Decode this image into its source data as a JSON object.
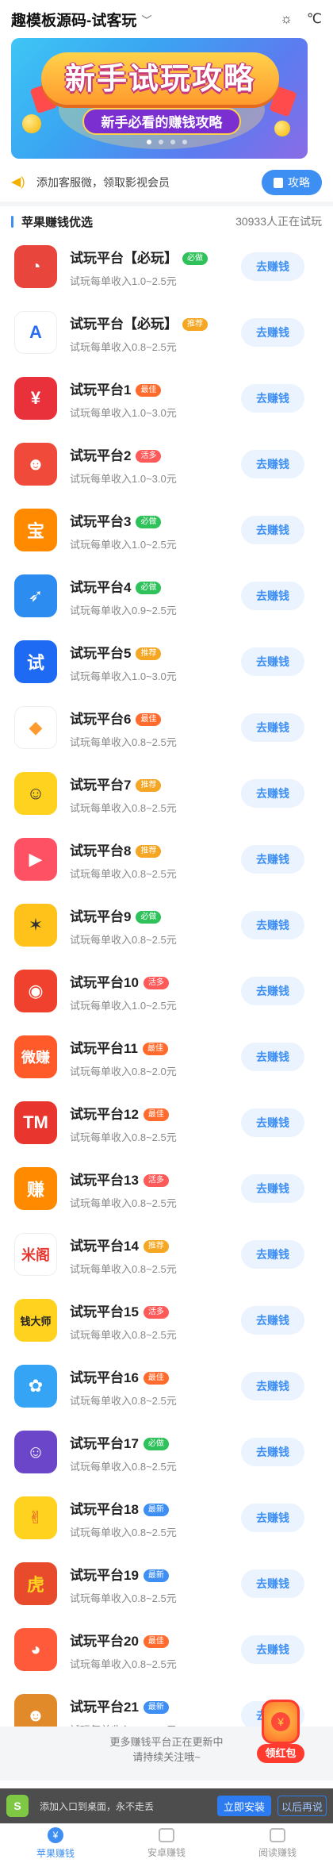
{
  "header": {
    "title": "趣模板源码-试客玩",
    "weather_sun": "☼",
    "weather_unit": "℃"
  },
  "banner": {
    "headline": "新手试玩攻略",
    "subline": "新手必看的赚钱攻略"
  },
  "notice": {
    "text": "添加客服微，领取影视会员",
    "button_label": "攻略"
  },
  "section": {
    "title": "苹果赚钱优选",
    "counter": "30933人正在试玩"
  },
  "go_label": "去赚钱",
  "tag_colors": {
    "必做": "#2fc25b",
    "推荐": "#f5a623",
    "最佳": "#ff6b2c",
    "活多": "#ff5a5a",
    "最新": "#3d8ff3"
  },
  "apps": [
    {
      "name": "试玩平台【必玩】",
      "tag": "必做",
      "income": "试玩每单收入1.0~2.5元",
      "icon_name": "pie-clock-icon",
      "icon_color": "#e8453c",
      "glyph": "◔"
    },
    {
      "name": "试玩平台【必玩】",
      "tag": "推荐",
      "income": "试玩每单收入0.8~2.5元",
      "icon_name": "letter-a-icon",
      "icon_color": "#ffffff",
      "glyph": "A",
      "glyph_color": "#2a6cf0"
    },
    {
      "name": "试玩平台1",
      "tag": "最佳",
      "income": "试玩每单收入1.0~3.0元",
      "icon_name": "yen-icon",
      "icon_color": "#e8313a",
      "glyph": "¥"
    },
    {
      "name": "试玩平台2",
      "tag": "活多",
      "income": "试玩每单收入1.0~3.0元",
      "icon_name": "face-hat-icon",
      "icon_color": "#f04b3a",
      "glyph": "☻"
    },
    {
      "name": "试玩平台3",
      "tag": "必做",
      "income": "试玩每单收入1.0~2.5元",
      "icon_name": "pig-bank-icon",
      "icon_color": "#ff8a00",
      "glyph": "宝"
    },
    {
      "name": "试玩平台4",
      "tag": "必做",
      "income": "试玩每单收入0.9~2.5元",
      "icon_name": "rocket-icon",
      "icon_color": "#2d8cf0",
      "glyph": "➶"
    },
    {
      "name": "试玩平台5",
      "tag": "推荐",
      "income": "试玩每单收入1.0~3.0元",
      "icon_name": "shi-char-icon",
      "icon_color": "#1f6af2",
      "glyph": "试"
    },
    {
      "name": "试玩平台6",
      "tag": "最佳",
      "income": "试玩每单收入0.8~2.5元",
      "icon_name": "play-diamond-icon",
      "icon_color": "#ffffff",
      "glyph": "◆",
      "glyph_color": "#ff9a2e"
    },
    {
      "name": "试玩平台7",
      "tag": "推荐",
      "income": "试玩每单收入0.8~2.5元",
      "icon_name": "avatar-boy-icon",
      "icon_color": "#ffd21f",
      "glyph": "☺",
      "glyph_color": "#333"
    },
    {
      "name": "试玩平台8",
      "tag": "推荐",
      "income": "试玩每单收入0.8~2.5元",
      "icon_name": "play-badge-icon",
      "icon_color": "#ff5164",
      "glyph": "▶"
    },
    {
      "name": "试玩平台9",
      "tag": "必做",
      "income": "试玩每单收入0.8~2.5元",
      "icon_name": "bee-icon",
      "icon_color": "#ffc21a",
      "glyph": "✶",
      "glyph_color": "#333"
    },
    {
      "name": "试玩平台10",
      "tag": "活多",
      "income": "试玩每单收入1.0~2.5元",
      "icon_name": "monster-icon",
      "icon_color": "#f0412f",
      "glyph": "◉"
    },
    {
      "name": "试玩平台11",
      "tag": "最佳",
      "income": "试玩每单收入0.8~2.0元",
      "icon_name": "weizhuan-icon",
      "icon_color": "#ff5a2a",
      "glyph": "微赚",
      "glyph_size": "18px"
    },
    {
      "name": "试玩平台12",
      "tag": "最佳",
      "income": "试玩每单收入0.8~2.5元",
      "icon_name": "tm-icon",
      "icon_color": "#e8352e",
      "glyph": "TM"
    },
    {
      "name": "试玩平台13",
      "tag": "活多",
      "income": "试玩每单收入0.8~2.5元",
      "icon_name": "zhuan-char-icon",
      "icon_color": "#ff8a00",
      "glyph": "赚"
    },
    {
      "name": "试玩平台14",
      "tag": "推荐",
      "income": "试玩每单收入0.8~2.5元",
      "icon_name": "mique-icon",
      "icon_color": "#ffffff",
      "glyph": "米阁",
      "glyph_color": "#e8352e",
      "glyph_size": "18px"
    },
    {
      "name": "试玩平台15",
      "tag": "活多",
      "income": "试玩每单收入0.8~2.5元",
      "icon_name": "qiandashi-icon",
      "icon_color": "#ffd21f",
      "glyph": "钱大师",
      "glyph_color": "#222",
      "glyph_size": "13px"
    },
    {
      "name": "试玩平台16",
      "tag": "最佳",
      "income": "试玩每单收入0.8~2.5元",
      "icon_name": "penguin-icon",
      "icon_color": "#35a4f5",
      "glyph": "✿"
    },
    {
      "name": "试玩平台17",
      "tag": "必做",
      "income": "试玩每单收入0.8~2.5元",
      "icon_name": "cowboy-icon",
      "icon_color": "#6b46c9",
      "glyph": "☺"
    },
    {
      "name": "试玩平台18",
      "tag": "最新",
      "income": "试玩每单收入0.8~2.5元",
      "icon_name": "hand-victory-icon",
      "icon_color": "#ffd21f",
      "glyph": "✌",
      "glyph_color": "#e0542a"
    },
    {
      "name": "试玩平台19",
      "tag": "最新",
      "income": "试玩每单收入0.8~2.5元",
      "icon_name": "tiger-icon",
      "icon_color": "#e84a2c",
      "glyph": "虎",
      "glyph_color": "#ffd21f"
    },
    {
      "name": "试玩平台20",
      "tag": "最佳",
      "income": "试玩每单收入0.8~2.5元",
      "icon_name": "raccoon-icon",
      "icon_color": "#ff5a3a",
      "glyph": "◕"
    },
    {
      "name": "试玩平台21",
      "tag": "最新",
      "income": "试玩每单收入0.8~2.5元",
      "icon_name": "squirrel-icon",
      "icon_color": "#e08a2a",
      "glyph": "☻"
    }
  ],
  "footer_more": {
    "line1": "更多赚钱平台正在更新中",
    "line2": "请持续关注哦~"
  },
  "redpack": {
    "label": "领红包",
    "glyph": "¥"
  },
  "install_bar": {
    "text": "添加入口到桌面，永不走丢",
    "install_label": "立即安装",
    "later_label": "以后再说",
    "icon_glyph": "S"
  },
  "tabs": [
    {
      "label": "苹果赚钱",
      "icon_name": "apple-money-icon",
      "active": true,
      "glyph": "¥"
    },
    {
      "label": "安卓赚钱",
      "icon_name": "android-chart-icon",
      "active": false
    },
    {
      "label": "阅读赚钱",
      "icon_name": "book-icon",
      "active": false
    }
  ]
}
